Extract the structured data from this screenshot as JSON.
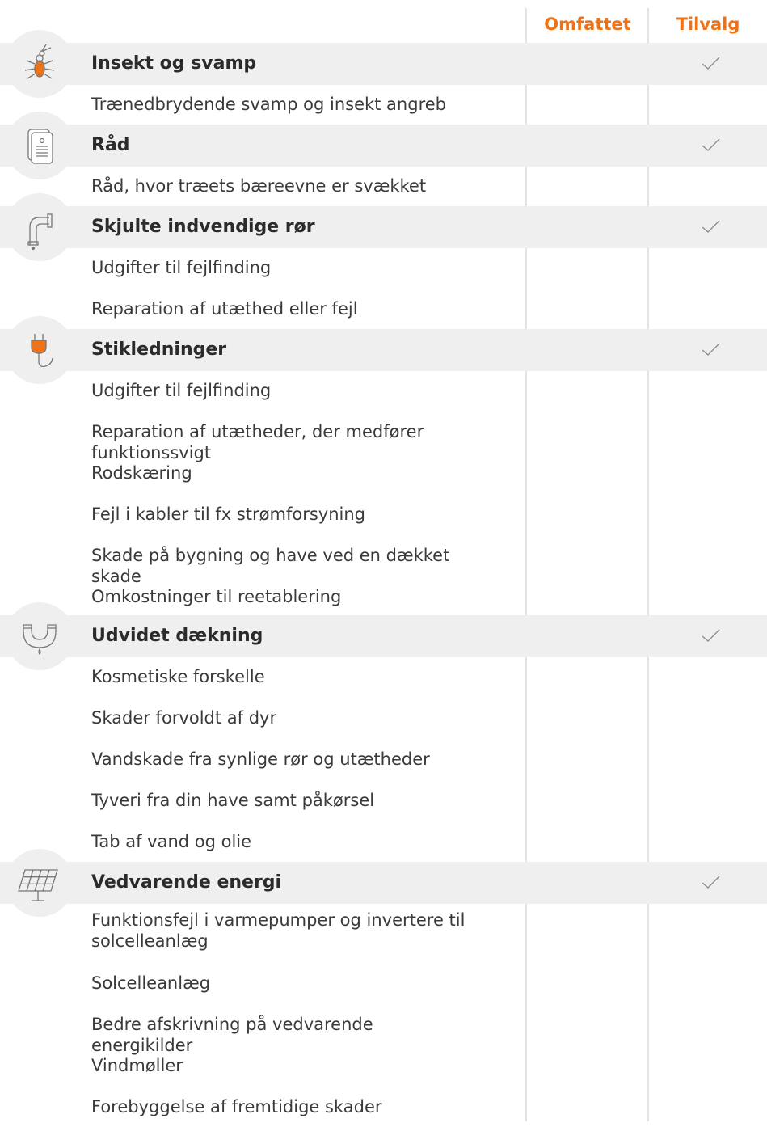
{
  "header": {
    "included_label": "Omfattet",
    "optional_label": "Tilvalg"
  },
  "colors": {
    "accent": "#ee7217",
    "row_bg": "#efefef",
    "divider": "#e3e3e3",
    "check": "#888888"
  },
  "categories": [
    {
      "icon": "insect-icon",
      "title": "Insekt og svamp",
      "optional": true,
      "items": [
        "Trænedbrydende svamp og insekt angreb"
      ]
    },
    {
      "icon": "document-icon",
      "title": "Råd",
      "optional": true,
      "items": [
        "Råd, hvor træets bæreevne er svækket"
      ]
    },
    {
      "icon": "pipe-icon",
      "title": "Skjulte indvendige rør",
      "optional": true,
      "items": [
        "Udgifter til fejlfinding",
        "Reparation af utæthed eller fejl"
      ]
    },
    {
      "icon": "plug-icon",
      "title": "Stikledninger",
      "optional": true,
      "items": [
        "Udgifter til fejlfinding",
        "Reparation af utætheder, der medfører funktionssvigt",
        "Rodskæring",
        "Fejl i kabler til fx strømforsyning",
        "Skade på bygning og have ved en dækket skade",
        "Omkostninger til reetablering"
      ]
    },
    {
      "icon": "drain-pipe-icon",
      "title": "Udvidet dækning",
      "optional": true,
      "items": [
        "Kosmetiske forskelle",
        "Skader forvoldt af dyr",
        "Vandskade fra synlige rør og utætheder",
        "Tyveri fra din have samt påkørsel",
        "Tab af vand og olie"
      ]
    },
    {
      "icon": "solar-panel-icon",
      "title": "Vedvarende energi",
      "optional": true,
      "items": [
        "Funktionsfejl i varmepumper og invertere til solcelleanlæg",
        "Solcelleanlæg",
        "Bedre afskrivning på vedvarende energikilder",
        "Vindmøller",
        "Forebyggelse af fremtidige skader"
      ]
    }
  ]
}
